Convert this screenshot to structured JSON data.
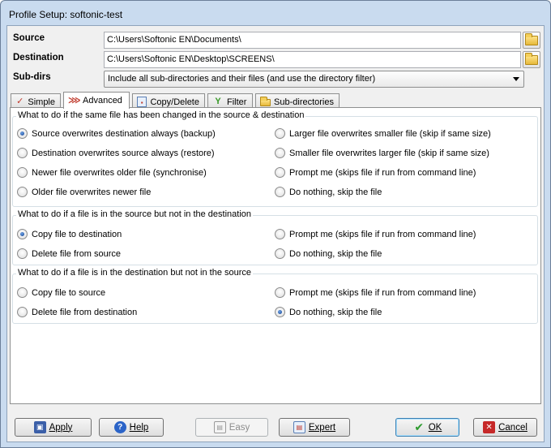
{
  "window": {
    "title": "Profile Setup: softonic-test"
  },
  "fields": {
    "source_label": "Source",
    "source_value": "C:\\Users\\Softonic EN\\Documents\\",
    "destination_label": "Destination",
    "destination_value": "C:\\Users\\Softonic EN\\Desktop\\SCREENS\\",
    "subdirs_label": "Sub-dirs",
    "subdirs_value": "Include all sub-directories and their files (and use the directory filter)"
  },
  "tabs": [
    {
      "label": "Simple",
      "icon": "simple-icon"
    },
    {
      "label": "Advanced",
      "icon": "advanced-icon",
      "active": true
    },
    {
      "label": "Copy/Delete",
      "icon": "copy-delete-icon"
    },
    {
      "label": "Filter",
      "icon": "filter-icon"
    },
    {
      "label": "Sub-directories",
      "icon": "folder-icon"
    }
  ],
  "groups": [
    {
      "title": "What to do if the same file has been changed in the source & destination",
      "options": [
        {
          "label": "Source overwrites destination always (backup)",
          "checked": true
        },
        {
          "label": "Larger file overwrites smaller file (skip if same size)",
          "checked": false
        },
        {
          "label": "Destination overwrites source always (restore)",
          "checked": false
        },
        {
          "label": "Smaller file overwrites larger file (skip if same size)",
          "checked": false
        },
        {
          "label": "Newer file overwrites older file (synchronise)",
          "checked": false
        },
        {
          "label": "Prompt me (skips file if run from command line)",
          "checked": false
        },
        {
          "label": "Older file overwrites newer file",
          "checked": false
        },
        {
          "label": "Do nothing, skip the file",
          "checked": false
        }
      ]
    },
    {
      "title": "What to do if a file is in the source but not in the destination",
      "options": [
        {
          "label": "Copy file to destination",
          "checked": true
        },
        {
          "label": "Prompt me  (skips file if run from command line)",
          "checked": false
        },
        {
          "label": "Delete file from source",
          "checked": false
        },
        {
          "label": "Do nothing, skip the file",
          "checked": false
        }
      ]
    },
    {
      "title": "What to do if a file is in the destination but not in the source",
      "options": [
        {
          "label": "Copy file to source",
          "checked": false
        },
        {
          "label": "Prompt me  (skips file if run from command line)",
          "checked": false
        },
        {
          "label": "Delete file from destination",
          "checked": false
        },
        {
          "label": "Do nothing, skip the file",
          "checked": true
        }
      ]
    }
  ],
  "buttons": {
    "apply": "Apply",
    "help": "Help",
    "easy": "Easy",
    "expert": "Expert",
    "ok": "OK",
    "cancel": "Cancel"
  },
  "colors": {
    "ok_check": "#2e9b2e",
    "cancel_x": "#c62828",
    "help_blue": "#2b64c8",
    "apply_disk": "#3b5fa8"
  }
}
